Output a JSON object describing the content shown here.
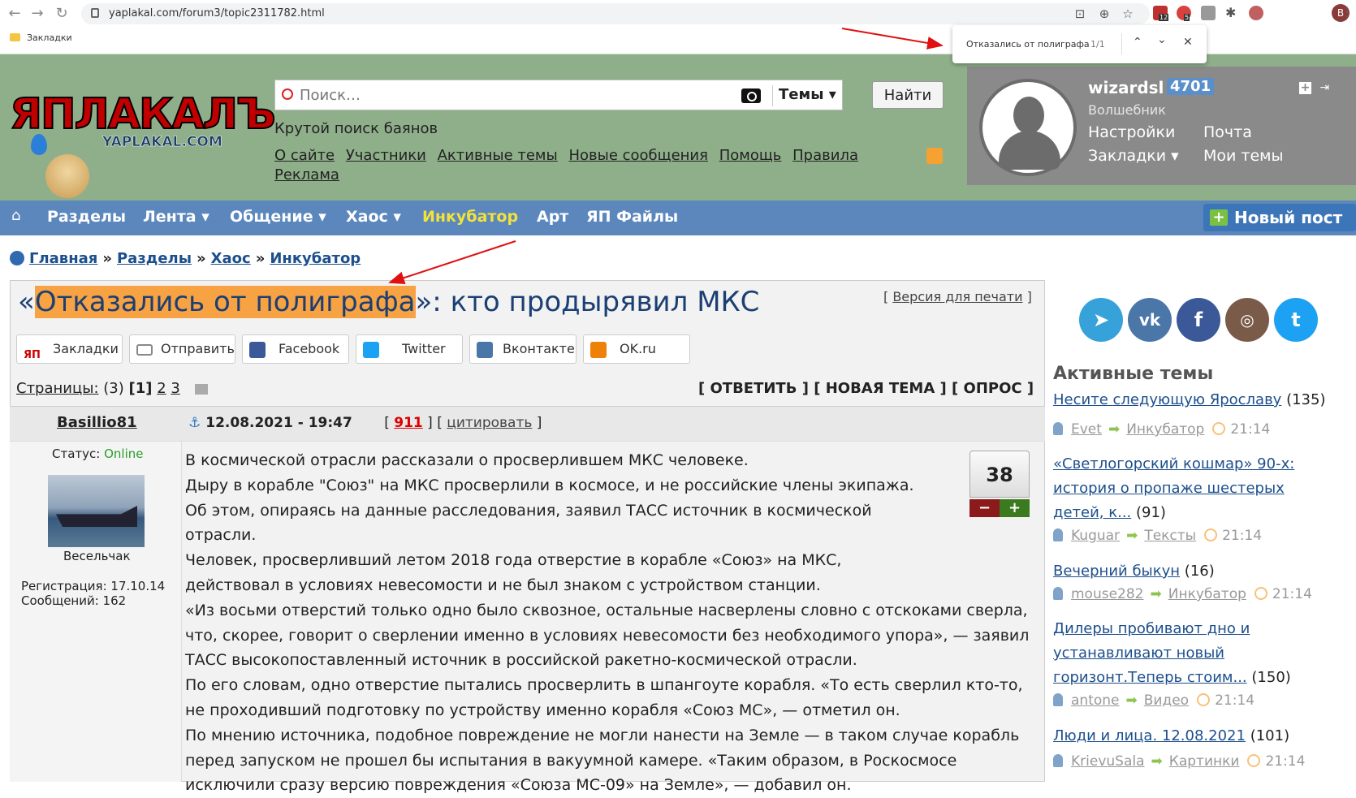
{
  "browser": {
    "url": "yaplakal.com/forum3/topic2311782.html",
    "bookmarks_label": "Закладки",
    "extension_badges": [
      "12",
      "5"
    ],
    "profile_initial": "B",
    "find": {
      "query": "Отказались от полиграфа",
      "count": "1/1"
    }
  },
  "header": {
    "logo_text": "ЯПЛАКАЛЪ",
    "logo_sub": "YAPLAKAL.COM",
    "search": {
      "placeholder": "Поиск…",
      "scope": "Темы",
      "button": "Найти"
    },
    "tagline": "Крутой поиск баянов",
    "links": [
      "О сайте",
      "Участники",
      "Активные темы",
      "Новые сообщения",
      "Помощь",
      "Правила",
      "Реклама"
    ]
  },
  "user": {
    "name": "wizardsl",
    "count": "4701",
    "rank": "Волшебник",
    "links": [
      "Настройки",
      "Почта",
      "Закладки ▾",
      "Мои темы"
    ]
  },
  "navbar": {
    "items": [
      "Разделы",
      "Лента ▾",
      "Общение ▾",
      "Хаос ▾",
      "Инкубатор",
      "Арт",
      "ЯП Файлы"
    ],
    "new_post": "Новый пост"
  },
  "breadcrumb": [
    "Главная",
    "Разделы",
    "Хаос",
    "Инкубатор"
  ],
  "topic": {
    "title_pre": "«",
    "title_hl": "Отказались от полиграфа",
    "title_post": "»: кто продырявил МКС",
    "print_label": "Версия для печати",
    "share": [
      "Закладки",
      "Отправить",
      "Facebook",
      "Twitter",
      "Вконтакте",
      "OK.ru"
    ],
    "pages_label": "Страницы:",
    "pages_total": "(3)",
    "pages": [
      "[1]",
      "2",
      "3"
    ],
    "actions": [
      "[ ОТВЕТИТЬ ]",
      "[ НОВАЯ ТЕМА ]",
      "[ ОПРОС ]"
    ]
  },
  "post": {
    "author": "Basillio81",
    "date": "12.08.2021 - 19:47",
    "number": "911",
    "quote": "цитировать",
    "status_label": "Статус:",
    "status": "Online",
    "role": "Весельчак",
    "registration": "Регистрация: 17.10.14",
    "messages": "Сообщений: 162",
    "rating": "38",
    "paragraphs": [
      "В космической отрасли рассказали о просверлившем МКС человеке.",
      "Дыру в корабле \"Союз\" на МКС просверлили в космосе, и не российские члены экипажа. Об этом, опираясь на данные расследования, заявил ТАСС источник в космической отрасли.",
      "Человек, просверливший летом 2018 года отверстие в корабле «Союз» на МКС, действовал в условиях невесомости и не был знаком с устройством станции.",
      "«Из восьми отверстий только одно было сквозное, остальные насверлены словно с отскоками сверла, что, скорее, говорит о сверлении именно в условиях невесомости без необходимого упора», — заявил ТАСС высокопоставленный источник в российской ракетно-космической отрасли.",
      "По его словам, одно отверстие пытались просверлить в шпангоуте корабля. «То есть сверлил кто-то, не проходивший подготовку по устройству именно корабля «Союз МС», — отметил он.",
      "По мнению источника, подобное повреждение не могли нанести на Земле — в таком случае корабль перед запуском не прошел бы испытания в вакуумной камере. «Таким образом, в Роскосмосе исключили сразу версию повреждения «Союза МС-09» на Земле», — добавил он."
    ]
  },
  "sidebar": {
    "social": [
      "telegram-icon",
      "vk-icon",
      "facebook-icon",
      "instagram-icon",
      "twitter-icon"
    ],
    "active_title": "Активные темы",
    "topics": [
      {
        "title": "Несите следующую Ярославу",
        "count": "(135)",
        "user": "Evet",
        "section": "Инкубатор",
        "time": "21:14"
      },
      {
        "title": "«Светлогорский кошмар» 90-х: история о пропаже шестерых детей, к...",
        "count": "(91)",
        "user": "Kuguar",
        "section": "Тексты",
        "time": "21:14"
      },
      {
        "title": "Вечерний быкун",
        "count": "(16)",
        "user": "mouse282",
        "section": "Инкубатор",
        "time": "21:14"
      },
      {
        "title": "Дилеры пробивают дно и устанавливают новый горизонт.Теперь стоим...",
        "count": "(150)",
        "user": "antone",
        "section": "Видео",
        "time": "21:14"
      },
      {
        "title": "Люди и лица. 12.08.2021",
        "count": "(101)",
        "user": "KrievuSala",
        "section": "Картинки",
        "time": "21:14"
      }
    ]
  },
  "colors": {
    "header_bg": "#8faf8a",
    "navbar_bg": "#5b87bd",
    "highlight": "#f7a243",
    "link": "#1c4f8c"
  }
}
